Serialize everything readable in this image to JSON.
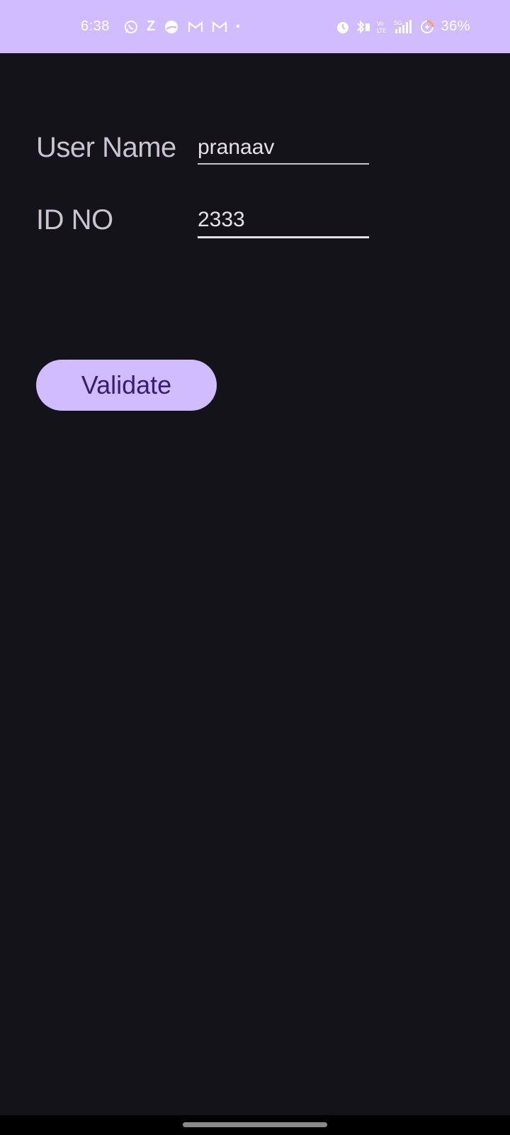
{
  "status_bar": {
    "time": "6:38",
    "z_label": "Z",
    "dot": "•",
    "battery": "36%",
    "icons_left": [
      "whatsapp-icon",
      "z-app-icon",
      "moon-app-icon",
      "gmail-icon",
      "gmail-icon",
      "notification-dot-icon"
    ],
    "icons_right": [
      "alarm-icon",
      "bluetooth-icon",
      "volte-icon",
      "signal-5g-icon",
      "battery-saver-icon"
    ],
    "background": "#d0bcff"
  },
  "form": {
    "username_label": "User Name",
    "username_value": "pranaav",
    "id_label": "ID NO",
    "id_value": "2333"
  },
  "validate_button": {
    "label": "Validate"
  },
  "colors": {
    "background": "#15131a",
    "accent": "#d0bcff",
    "button_text": "#381e72"
  }
}
